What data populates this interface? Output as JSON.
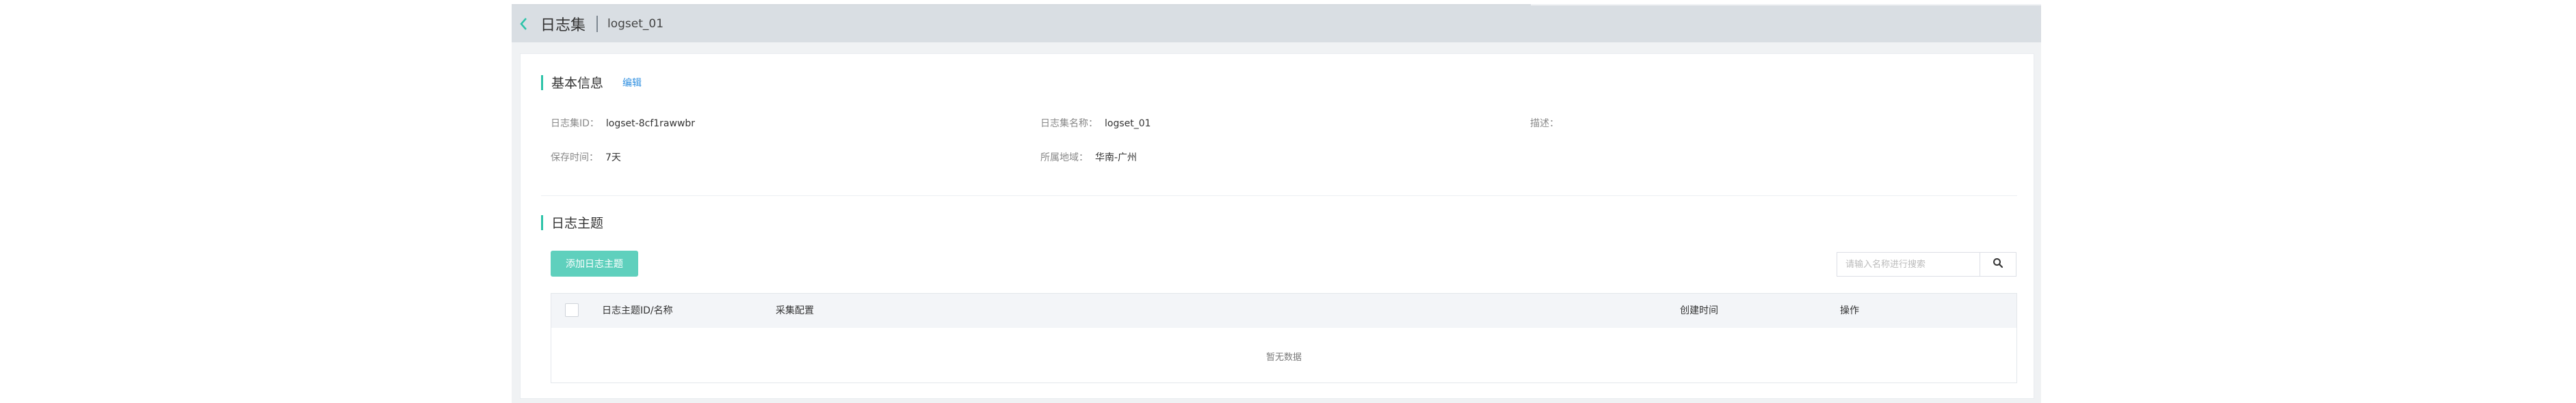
{
  "header": {
    "title": "日志集",
    "subtitle": "logset_01"
  },
  "basic_info": {
    "title": "基本信息",
    "edit_label": "编辑",
    "fields": [
      {
        "label": "日志集ID：",
        "value": "logset-8cf1rawwbr"
      },
      {
        "label": "日志集名称：",
        "value": "logset_01"
      },
      {
        "label": "描述：",
        "value": ""
      },
      {
        "label": "保存时间：",
        "value": "7天"
      },
      {
        "label": "所属地域：",
        "value": "华南-广州"
      }
    ]
  },
  "topics": {
    "title": "日志主题",
    "add_button": "添加日志主题",
    "search_placeholder": "请输入名称进行搜索",
    "columns": [
      "日志主题ID/名称",
      "采集配置",
      "创建时间",
      "操作"
    ],
    "empty_text": "暂无数据"
  },
  "colors": {
    "accent": "#2cc3a8",
    "button": "#5fd0bd",
    "link": "#2f8fe0",
    "header_bg": "#d9dee3"
  },
  "icons": {
    "back": "chevron-left-icon",
    "search": "search-icon"
  }
}
